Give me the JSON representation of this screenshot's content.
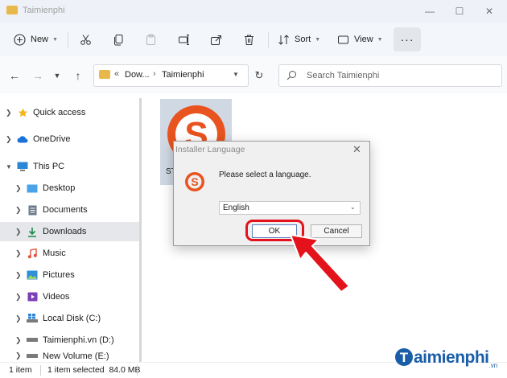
{
  "window": {
    "title": "Taimienphi"
  },
  "toolbar": {
    "new_label": "New",
    "sort_label": "Sort",
    "view_label": "View",
    "more_label": "···"
  },
  "address": {
    "overflow": "«",
    "crumb_1": "Dow...",
    "separator": "›",
    "crumb_2": "Taimienphi"
  },
  "search": {
    "placeholder": "Search Taimienphi"
  },
  "sidebar": {
    "items": [
      {
        "label": "Quick access"
      },
      {
        "label": "OneDrive"
      },
      {
        "label": "This PC"
      },
      {
        "label": "Desktop"
      },
      {
        "label": "Documents"
      },
      {
        "label": "Downloads"
      },
      {
        "label": "Music"
      },
      {
        "label": "Pictures"
      },
      {
        "label": "Videos"
      },
      {
        "label": "Local Disk (C:)"
      },
      {
        "label": "Taimienphi.vn (D:)"
      },
      {
        "label": "New Volume (E:)"
      }
    ]
  },
  "file": {
    "name_partial": "ST"
  },
  "dialog": {
    "title": "Installer Language",
    "message": "Please select a language.",
    "selected_language": "English",
    "ok_label": "OK",
    "cancel_label": "Cancel"
  },
  "status": {
    "count": "1 item",
    "selection": "1 item selected  84.0 MB"
  },
  "watermark": {
    "text": "aimienphi",
    "suffix": ".vn"
  },
  "colors": {
    "accent_red": "#e3121b",
    "logo_orange": "#e8531f",
    "brand_blue": "#1a5ea8",
    "folder_yellow": "#e8b84a"
  }
}
